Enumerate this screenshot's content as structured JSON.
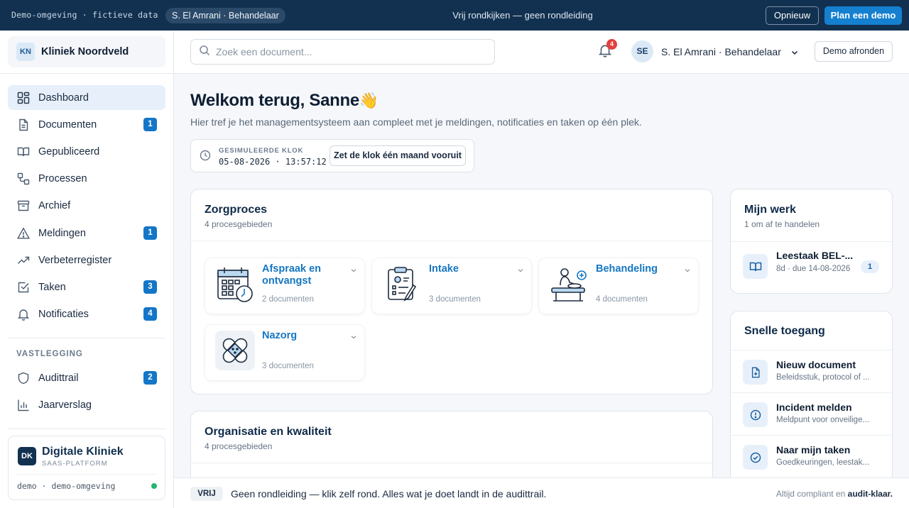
{
  "demobar": {
    "env": "Demo-omgeving · fictieve data",
    "role": "S. El Amrani · Behandelaar",
    "center": "Vrij rondkijken — geen rondleiding",
    "restart": "Opnieuw",
    "plan": "Plan een demo"
  },
  "sidebar": {
    "clinic_badge": "KN",
    "clinic_name": "Kliniek Noordveld",
    "items": [
      {
        "label": "Dashboard",
        "count": ""
      },
      {
        "label": "Documenten",
        "count": "1"
      },
      {
        "label": "Gepubliceerd",
        "count": ""
      },
      {
        "label": "Processen",
        "count": ""
      },
      {
        "label": "Archief",
        "count": ""
      },
      {
        "label": "Meldingen",
        "count": "1"
      },
      {
        "label": "Verbeterregister",
        "count": ""
      },
      {
        "label": "Taken",
        "count": "3"
      },
      {
        "label": "Notificaties",
        "count": "4"
      }
    ],
    "section": "VASTLEGGING",
    "items2": [
      {
        "label": "Audittrail",
        "count": "2"
      },
      {
        "label": "Jaarverslag",
        "count": ""
      }
    ],
    "platform": {
      "badge": "DK",
      "name": "Digitale Kliniek",
      "sub": "SAAS-PLATFORM",
      "env": "demo · demo-omgeving"
    }
  },
  "header": {
    "search_placeholder": "Zoek een document...",
    "notif_count": "4",
    "avatar": "SE",
    "user": "S. El Amrani · Behandelaar",
    "finish": "Demo afronden"
  },
  "main": {
    "welcome": "Welkom terug, Sanne",
    "wave": "👋",
    "intro": "Hier tref je het managementsysteem aan compleet met je meldingen, notificaties en taken op één plek.",
    "clock": {
      "label": "GESIMULEERDE KLOK",
      "value": "05-08-2026 · 13:57:12",
      "button": "Zet de klok één maand vooruit"
    },
    "zorgproces": {
      "title": "Zorgproces",
      "sub": "4 procesgebieden",
      "items": [
        {
          "title": "Afspraak en ontvangst",
          "count": "2 documenten"
        },
        {
          "title": "Intake",
          "count": "3 documenten"
        },
        {
          "title": "Behandeling",
          "count": "4 documenten"
        },
        {
          "title": "Nazorg",
          "count": "3 documenten"
        }
      ]
    },
    "organisatie": {
      "title": "Organisatie en kwaliteit",
      "sub": "4 procesgebieden"
    }
  },
  "mijnwerk": {
    "title": "Mijn werk",
    "sub": "1 om af te handelen",
    "item": {
      "title": "Leestaak BEL-...",
      "sub": "8d · due 14-08-2026",
      "count": "1"
    }
  },
  "snelle": {
    "title": "Snelle toegang",
    "items": [
      {
        "title": "Nieuw document",
        "sub": "Beleidsstuk, protocol of ..."
      },
      {
        "title": "Incident melden",
        "sub": "Meldpunt voor onveilige..."
      },
      {
        "title": "Naar mijn taken",
        "sub": "Goedkeuringen, leestak..."
      }
    ]
  },
  "footer": {
    "tag": "VRIJ",
    "msg": "Geen rondleiding — klik zelf rond. Alles wat je doet landt in de audittrail.",
    "right_pre": "Altijd compliant en ",
    "right_bold": "audit-klaar."
  }
}
